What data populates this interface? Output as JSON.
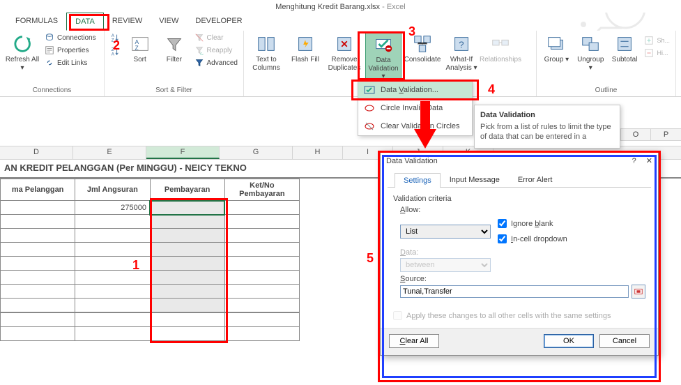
{
  "app": {
    "filename": "Menghitung Kredit Barang.xlsx",
    "app_suffix": " - Excel"
  },
  "tabs": {
    "formulas": "FORMULAS",
    "data": "DATA",
    "review": "REVIEW",
    "view": "VIEW",
    "developer": "DEVELOPER"
  },
  "ribbon": {
    "connections": {
      "refresh_all": "Refresh All",
      "connections": "Connections",
      "properties": "Properties",
      "edit_links": "Edit Links",
      "group_label": "Connections"
    },
    "sort_filter": {
      "sort": "Sort",
      "filter": "Filter",
      "clear": "Clear",
      "reapply": "Reapply",
      "advanced": "Advanced",
      "group_label": "Sort & Filter"
    },
    "data_tools": {
      "text_to_columns": "Text to Columns",
      "flash_fill": "Flash Fill",
      "remove_duplicates": "Remove Duplicates",
      "data_validation": "Data Validation",
      "consolidate": "Consolidate",
      "what_if": "What-If Analysis",
      "relationships": "Relationships"
    },
    "outline": {
      "group": "Group",
      "ungroup": "Ungroup",
      "subtotal": "Subtotal",
      "group_label": "Outline",
      "hide_detail": "Hide Detail",
      "show_detail": "Show Detail"
    }
  },
  "dv_menu": {
    "data_validation": "Data Validation...",
    "circle_invalid": "Circle Invalid Data",
    "clear_circles": "Clear Validation Circles"
  },
  "tooltip": {
    "title": "Data Validation",
    "body": "Pick from a list of rules to limit the type of data that can be entered in a"
  },
  "columns": [
    "",
    "D",
    "E",
    "F",
    "G",
    "H",
    "I",
    "J",
    "K"
  ],
  "grid": {
    "title": "AN KREDIT PELANGGAN (Per MINGGU) - NEICY TEKNO",
    "headers": [
      "ma Pelanggan",
      "Jml Angsuran",
      "Pembayaran",
      "Ket/No Pembayaran"
    ],
    "row1_c2": "275000"
  },
  "dialog": {
    "title": "Data Validation",
    "help": "?",
    "close": "✕",
    "tabs": {
      "settings": "Settings",
      "input_message": "Input Message",
      "error_alert": "Error Alert"
    },
    "criteria_label": "Validation criteria",
    "allow_label": "Allow:",
    "allow_value": "List",
    "ignore_blank": "Ignore blank",
    "incell_dropdown": "In-cell dropdown",
    "data_label": "Data:",
    "data_value": "between",
    "source_label": "Source:",
    "source_value": "Tunai,Transfer",
    "apply_changes": "Apply these changes to all other cells with the same settings",
    "clear_all": "Clear All",
    "ok": "OK",
    "cancel": "Cancel"
  },
  "anno": {
    "n1": "1",
    "n2": "2",
    "n3": "3",
    "n4": "4",
    "n5": "5"
  },
  "right_cols": [
    "O",
    "P"
  ]
}
